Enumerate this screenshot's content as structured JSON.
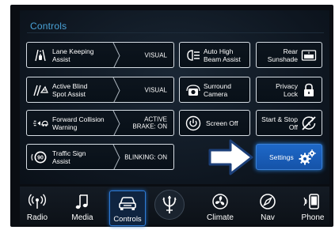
{
  "header": {
    "title": "Controls"
  },
  "tiles": {
    "lane_keeping": {
      "label_line1": "Lane Keeping",
      "label_line2": "Assist",
      "value": "VISUAL",
      "icon": "lane-keeping-icon"
    },
    "active_blind_spot": {
      "label_line1": "Active Blind",
      "label_line2": "Spot Assist",
      "value": "VISUAL",
      "icon": "blind-spot-icon"
    },
    "forward_collision": {
      "label_line1": "Forward Collision",
      "label_line2": "Warning",
      "value_line1": "ACTIVE",
      "value_line2": "BRAKE: ON",
      "icon": "collision-warning-icon"
    },
    "traffic_sign": {
      "label_line1": "Traffic Sign",
      "label_line2": "Assist",
      "value": "BLINKING: ON",
      "icon": "speed-sign-icon",
      "icon_text": "90"
    },
    "auto_high_beam": {
      "label_line1": "Auto High",
      "label_line2": "Beam Assist",
      "icon": "high-beam-icon"
    },
    "surround_camera": {
      "label_line1": "Surround",
      "label_line2": "Camera",
      "icon": "camera-icon"
    },
    "screen_off": {
      "label": "Screen Off",
      "icon": "power-icon"
    },
    "rear_sunshade": {
      "label_line1": "Rear",
      "label_line2": "Sunshade",
      "icon": "sunshade-icon"
    },
    "privacy_lock": {
      "label_line1": "Privacy",
      "label_line2": "Lock",
      "icon": "lock-icon"
    },
    "start_stop": {
      "label_line1": "Start & Stop",
      "label_line2": "Off",
      "icon": "start-stop-off-icon"
    },
    "settings": {
      "label": "Settings",
      "icon": "gears-icon"
    }
  },
  "nav": {
    "items": [
      {
        "label": "Radio",
        "icon": "radio-icon"
      },
      {
        "label": "Media",
        "icon": "music-note-icon"
      },
      {
        "label": "Controls",
        "icon": "car-icon",
        "active": true
      },
      {
        "label": "",
        "icon": "trident-logo-icon"
      },
      {
        "label": "Climate",
        "icon": "fan-icon"
      },
      {
        "label": "Nav",
        "icon": "compass-icon"
      },
      {
        "label": "Phone",
        "icon": "phone-icon"
      }
    ]
  },
  "colors": {
    "accent_blue": "#2f7bd4",
    "title_blue": "#4aa3d8",
    "tile_border": "#d6dde4",
    "background": "#0e1620"
  }
}
